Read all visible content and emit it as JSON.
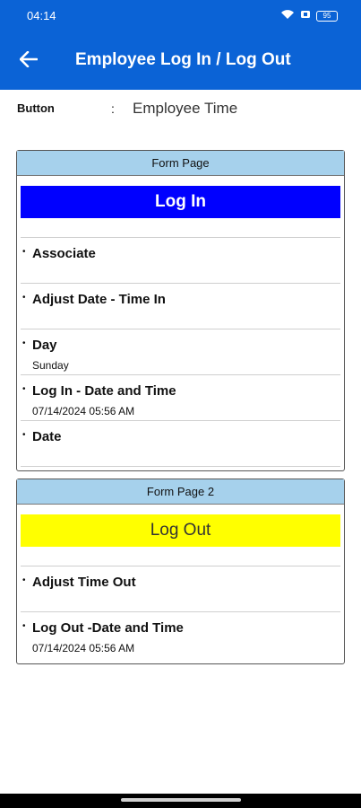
{
  "status_bar": {
    "time": "04:14",
    "battery": "95"
  },
  "app_bar": {
    "title": "Employee Log In / Log Out"
  },
  "info": {
    "label": "Button",
    "separator": ":",
    "value": "Employee Time"
  },
  "section1": {
    "header": "Form Page",
    "button_label": "Log In",
    "fields": [
      {
        "label": "Associate",
        "value": ""
      },
      {
        "label": "Adjust Date - Time In",
        "value": ""
      },
      {
        "label": "Day",
        "value": "Sunday"
      },
      {
        "label": "Log In - Date and Time",
        "value": "07/14/2024 05:56 AM"
      },
      {
        "label": "Date",
        "value": ""
      }
    ]
  },
  "section2": {
    "header": "Form Page 2",
    "button_label": "Log Out",
    "fields": [
      {
        "label": "Adjust Time Out",
        "value": ""
      },
      {
        "label": "Log Out -Date and Time",
        "value": "07/14/2024 05:56 AM"
      }
    ]
  },
  "colors": {
    "primary": "#0b63d6",
    "login_button": "#0000ff",
    "logout_button": "#ffff00",
    "section_header": "#a6d1ec"
  },
  "icons": {
    "back": "arrow-left-icon",
    "wifi": "wifi-icon",
    "battery": "battery-icon"
  }
}
